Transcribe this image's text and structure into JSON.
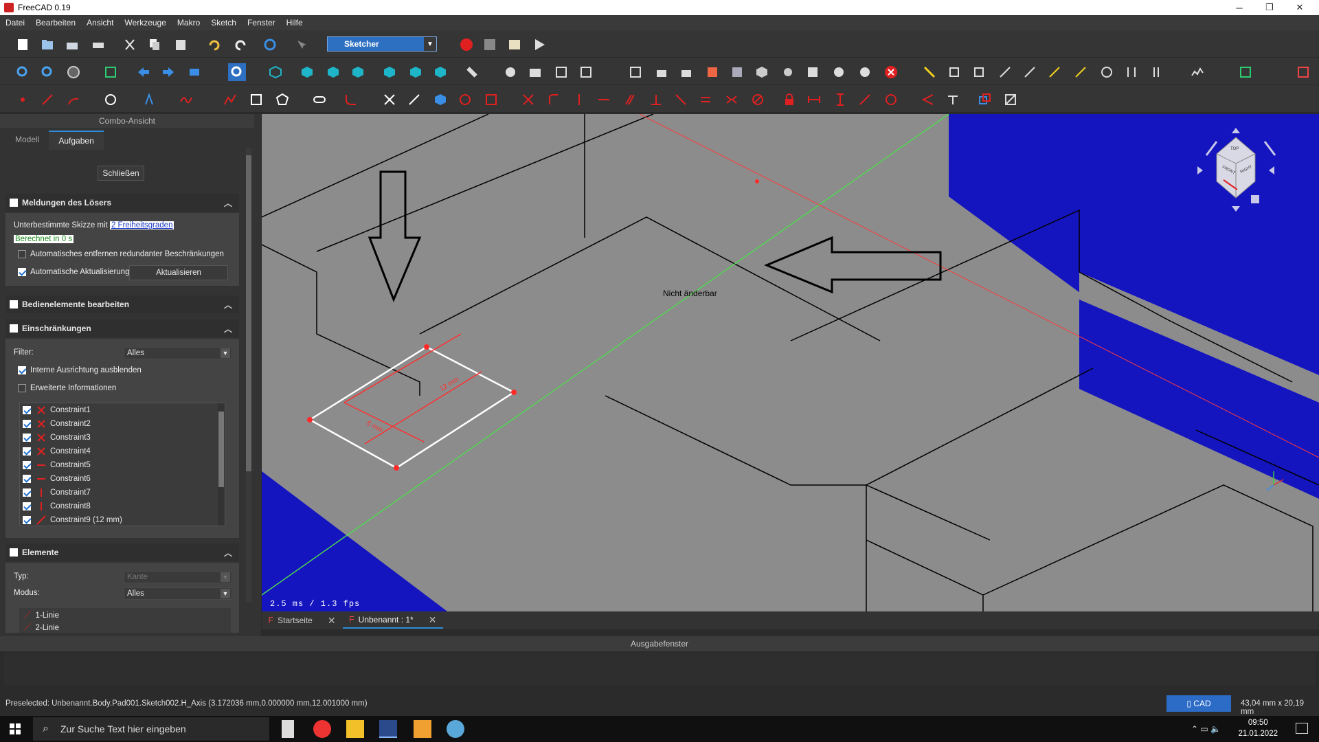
{
  "window": {
    "title": "FreeCAD 0.19",
    "minimize": "─",
    "restore": "❐",
    "close": "✕"
  },
  "menu": [
    "Datei",
    "Bearbeiten",
    "Ansicht",
    "Werkzeuge",
    "Makro",
    "Sketch",
    "Fenster",
    "Hilfe"
  ],
  "workbench": {
    "selected": "Sketcher"
  },
  "panel": {
    "title": "Combo-Ansicht",
    "tabs": [
      "Modell",
      "Aufgaben"
    ],
    "close_button": "Schließen",
    "solver": {
      "title": "Meldungen des Lösers",
      "status_prefix": "Unterbestimmte Skizze mit",
      "status_link": "2 Freiheitsgraden",
      "timing": "Berechnet in 0 s",
      "auto_remove": "Automatisches entfernen redundanter Beschränkungen",
      "auto_update": "Automatische Aktualisierung",
      "update_button": "Aktualisieren"
    },
    "edit_controls": {
      "title": "Bedienelemente bearbeiten"
    },
    "constraints": {
      "title": "Einschränkungen",
      "filter_label": "Filter:",
      "filter_value": "Alles",
      "hide_internal": "Interne Ausrichtung ausblenden",
      "extended_info": "Erweiterte Informationen",
      "items": [
        "Constraint1",
        "Constraint2",
        "Constraint3",
        "Constraint4",
        "Constraint5",
        "Constraint6",
        "Constraint7",
        "Constraint8",
        "Constraint9 (12 mm)"
      ]
    },
    "elements": {
      "title": "Elemente",
      "type_label": "Typ:",
      "type_value": "Kante",
      "mode_label": "Modus:",
      "mode_value": "Alles",
      "items": [
        "1-Linie",
        "2-Linie"
      ]
    }
  },
  "viewport": {
    "label_not_editable": "Nicht änderbar",
    "fps": "2.5 ms / 1.3 fps",
    "dim_12": "12 mm",
    "dim_6": "6 mm",
    "navcube_left": "FRONT",
    "navcube_right": "RIGHT",
    "navcube_top": "TOP"
  },
  "doc_tabs": [
    "Startseite",
    "Unbenannt : 1*"
  ],
  "output": {
    "title": "Ausgabefenster"
  },
  "status": {
    "text": "Preselected: Unbenannt.Body.Pad001.Sketch002.H_Axis (3.172036 mm,0.000000 mm,12.001000 mm)",
    "cad": "CAD",
    "dims": "43,04 mm x 20,19 mm"
  },
  "taskbar": {
    "search_placeholder": "Zur Suche Text hier eingeben",
    "time": "09:50",
    "date": "21.01.2022"
  }
}
